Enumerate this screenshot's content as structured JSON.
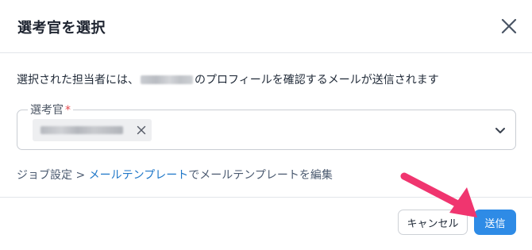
{
  "dialog": {
    "title": "選考官を選択",
    "close_icon": "close-icon"
  },
  "description": {
    "before": "選択された担当者には、",
    "after": "のプロフィールを確認するメールが送信されます"
  },
  "field": {
    "label": "選考官",
    "required_mark": "*",
    "chip_remove_icon": "x-icon",
    "dropdown_icon": "chevron-down-icon"
  },
  "link_line": {
    "prefix": "ジョブ設定 > ",
    "link": "メールテンプレート",
    "suffix": "でメールテンプレートを編集"
  },
  "buttons": {
    "cancel": "キャンセル",
    "send": "送信"
  },
  "colors": {
    "accent": "#2e8be6",
    "link": "#1f77c8",
    "required": "#e5484d",
    "annotation_arrow": "#f0356f"
  }
}
